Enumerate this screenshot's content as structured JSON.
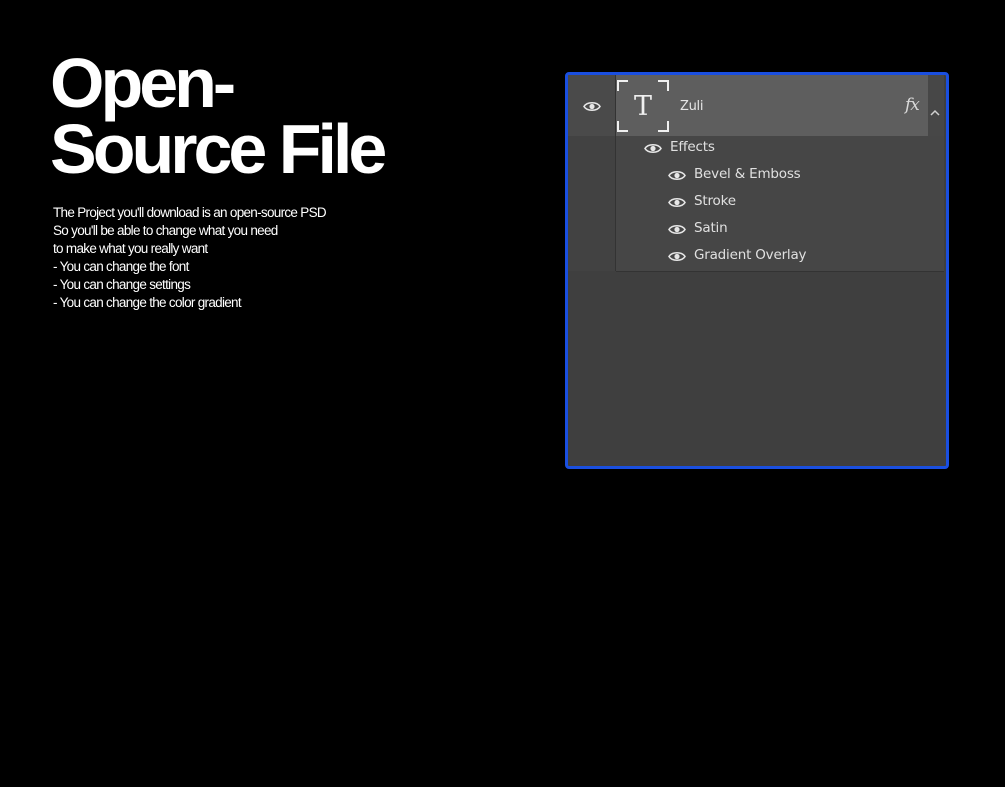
{
  "headline": {
    "line1": "Open-",
    "line2": "Source File"
  },
  "description": {
    "lines": [
      "The Project you'll download is an open-source PSD",
      "So you'll be able to change what you need",
      "to make what you really want",
      "- You can change the font",
      "- You can change settings",
      "- You can change the color gradient"
    ]
  },
  "layers_panel": {
    "border_color": "#1a4fe0",
    "layer": {
      "thumbnail_glyph": "T",
      "name": "Zuli",
      "fx_label": "fx"
    },
    "effects_label": "Effects",
    "effects": [
      "Bevel & Emboss",
      "Stroke",
      "Satin",
      "Gradient Overlay"
    ],
    "icons": {
      "visibility": "eye-icon",
      "layer_type": "text-layer-icon",
      "effects_badge": "fx-icon",
      "collapse": "chevron-up-icon"
    }
  }
}
